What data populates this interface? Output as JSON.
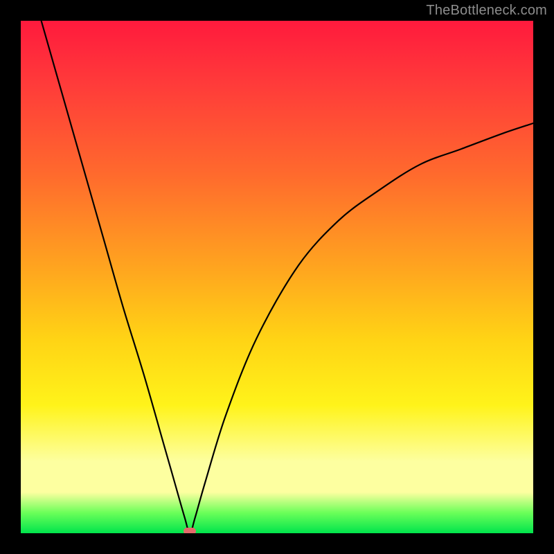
{
  "watermark": "TheBottleneck.com",
  "chart_data": {
    "type": "line",
    "title": "",
    "xlabel": "",
    "ylabel": "",
    "xlim": [
      0,
      100
    ],
    "ylim": [
      0,
      100
    ],
    "grid": false,
    "legend": false,
    "series": [
      {
        "name": "bottleneck-curve",
        "x": [
          4,
          8,
          12,
          16,
          20,
          24,
          28,
          30,
          32,
          33,
          34,
          36,
          40,
          46,
          54,
          62,
          70,
          78,
          86,
          94,
          100
        ],
        "values": [
          100,
          86,
          72,
          58,
          44,
          31,
          17,
          10,
          3,
          0,
          3,
          10,
          23,
          38,
          52,
          61,
          67,
          72,
          75,
          78,
          80
        ]
      }
    ],
    "optimum_marker": {
      "x": 33,
      "y": 0
    },
    "background_gradient": {
      "top": "#ff1a3d",
      "mid1": "#ff6a2d",
      "mid2": "#ffd315",
      "mid3": "#fdffa0",
      "bottom": "#00e44c"
    }
  }
}
